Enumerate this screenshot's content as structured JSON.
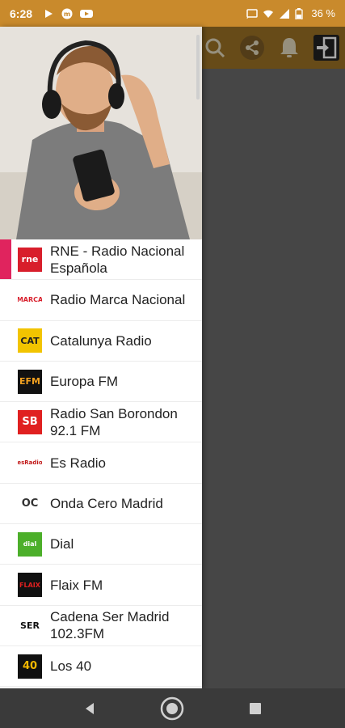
{
  "status_bar": {
    "time": "6:28",
    "battery": "36 %",
    "left_icons": [
      "play-icon",
      "m-icon",
      "youtube-icon"
    ],
    "right_icons": [
      "cast-icon",
      "wifi-icon",
      "signal-icon",
      "battery-icon"
    ]
  },
  "toolbar": {
    "icons": [
      "search-icon",
      "share-icon",
      "bell-icon",
      "exit-icon"
    ]
  },
  "drawer": {
    "stations": [
      {
        "name": "RNE - Radio Nacional Española",
        "logo_text": "rne",
        "logo_bg": "#d81e2b",
        "logo_fg": "#ffffff",
        "active": true
      },
      {
        "name": "Radio Marca Nacional",
        "logo_text": "MARCA",
        "logo_bg": "#ffffff",
        "logo_fg": "#d81e2b",
        "active": false
      },
      {
        "name": "Catalunya Radio",
        "logo_text": "CAT",
        "logo_bg": "#f2c400",
        "logo_fg": "#222222",
        "active": false
      },
      {
        "name": "Europa FM",
        "logo_text": "EFM",
        "logo_bg": "#111111",
        "logo_fg": "#f0a020",
        "active": false
      },
      {
        "name": "Radio San Borondon 92.1 FM",
        "logo_text": "SB",
        "logo_bg": "#e02020",
        "logo_fg": "#ffffff",
        "active": false
      },
      {
        "name": "Es Radio",
        "logo_text": "esRadio",
        "logo_bg": "#ffffff",
        "logo_fg": "#c01818",
        "active": false
      },
      {
        "name": "Onda Cero Madrid",
        "logo_text": "OC",
        "logo_bg": "#ffffff",
        "logo_fg": "#333333",
        "active": false
      },
      {
        "name": "Dial",
        "logo_text": "dial",
        "logo_bg": "#4caf2a",
        "logo_fg": "#ffffff",
        "active": false
      },
      {
        "name": "Flaix FM",
        "logo_text": "FLAIX",
        "logo_bg": "#111111",
        "logo_fg": "#e02020",
        "active": false
      },
      {
        "name": "Cadena Ser Madrid 102.3FM",
        "logo_text": "SER",
        "logo_bg": "#ffffff",
        "logo_fg": "#111111",
        "active": false
      },
      {
        "name": "Los 40",
        "logo_text": "40",
        "logo_bg": "#111111",
        "logo_fg": "#f5b800",
        "active": false
      }
    ]
  },
  "nav_bar": {
    "icons": [
      "back-icon",
      "home-icon",
      "recents-icon"
    ]
  },
  "colors": {
    "status_bar": "#c98a2c",
    "toolbar": "#8a6420",
    "active_indicator": "#e0245e"
  }
}
